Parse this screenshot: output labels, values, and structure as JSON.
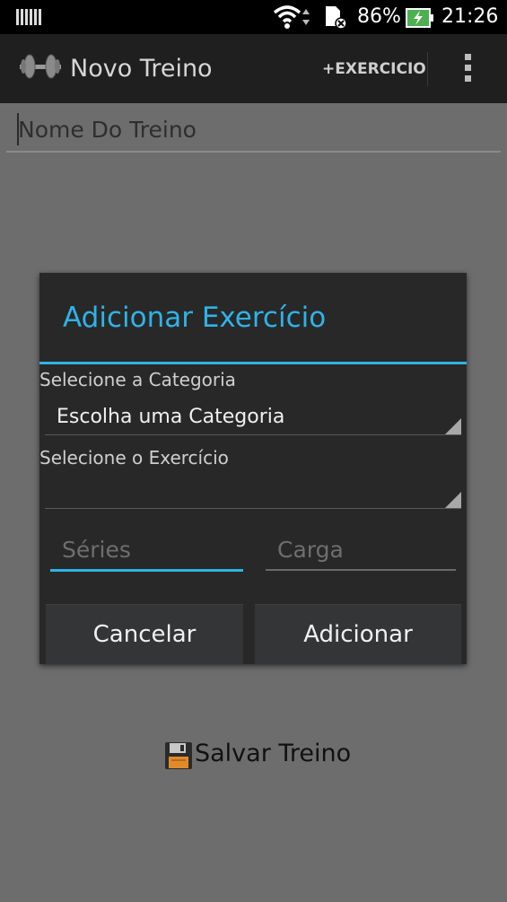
{
  "status_bar": {
    "battery_percent": "86%",
    "time": "21:26",
    "icons": [
      "signal-icon",
      "wifi-icon",
      "sd-card-icon",
      "battery-charging-icon"
    ]
  },
  "action_bar": {
    "title": "Novo Treino",
    "add_exercise_label": "+EXERCICIO",
    "icons": [
      "dumbbell-icon",
      "overflow-menu-icon"
    ]
  },
  "form": {
    "name_placeholder": "Nome Do Treino",
    "save_label": "Salvar Treino",
    "save_icon": "floppy-disk-icon"
  },
  "dialog": {
    "title": "Adicionar Exercício",
    "category_label": "Selecione a Categoria",
    "category_value": "Escolha uma Categoria",
    "exercise_label": "Selecione o Exercício",
    "exercise_value": "",
    "series_placeholder": "Séries",
    "carga_placeholder": "Carga",
    "cancel_label": "Cancelar",
    "add_label": "Adicionar"
  },
  "colors": {
    "accent": "#2fb3e6",
    "dialog_bg": "#282828",
    "dim_overlay": "#6d6d6d",
    "battery_green": "#4caf50"
  }
}
